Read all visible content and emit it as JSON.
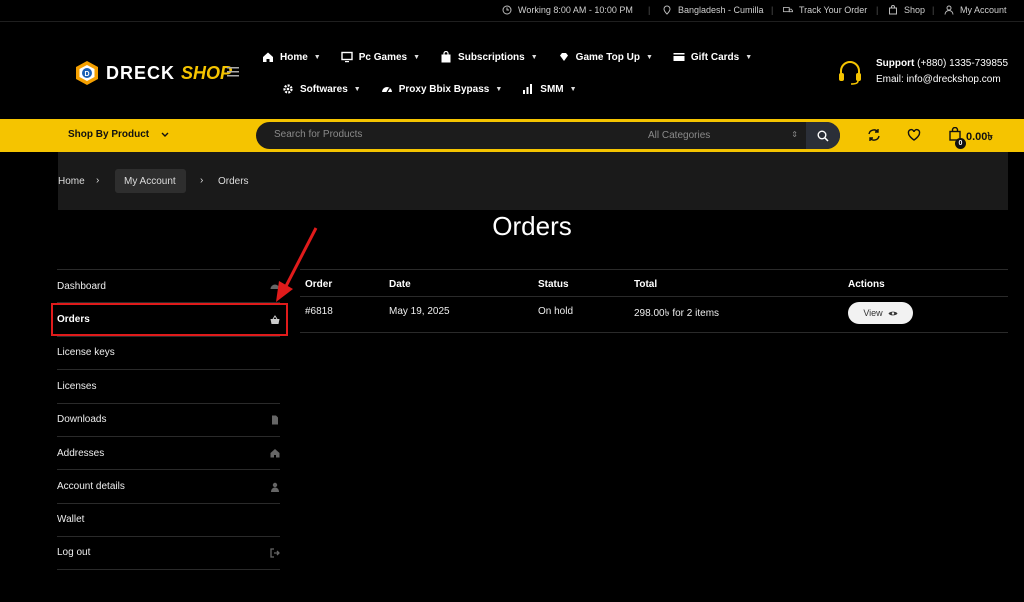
{
  "topbar": {
    "hours": "Working 8:00 AM - 10:00 PM",
    "location": "Bangladesh - Cumilla",
    "track": "Track Your Order",
    "shop": "Shop",
    "account": "My Account"
  },
  "brand": {
    "name_1": "DRECK",
    "name_2": "SHOP",
    "accent": "#f5c400"
  },
  "nav": {
    "row1": [
      {
        "label": "Home",
        "icon": "home-icon"
      },
      {
        "label": "Pc Games",
        "icon": "monitor-icon"
      },
      {
        "label": "Subscriptions",
        "icon": "bag-icon"
      },
      {
        "label": "Game Top Up",
        "icon": "diamond-icon"
      },
      {
        "label": "Gift Cards",
        "icon": "card-icon"
      }
    ],
    "row2": [
      {
        "label": "Softwares",
        "icon": "gear-icon"
      },
      {
        "label": "Proxy Bbix Bypass",
        "icon": "gauge-icon"
      },
      {
        "label": "SMM",
        "icon": "bars-icon"
      }
    ]
  },
  "support": {
    "label": "Support",
    "phone": "(+880) 1335-739855",
    "email": "Email: info@dreckshop.com"
  },
  "ybar": {
    "shop_by": "Shop By Product",
    "search_placeholder": "Search for Products",
    "category": "All Categories",
    "cart_count": "0",
    "cart_total": "0.00৳"
  },
  "breadcrumb": {
    "home": "Home",
    "account": "My Account",
    "current": "Orders"
  },
  "page": {
    "title": "Orders"
  },
  "sidebar": {
    "items": [
      {
        "label": "Dashboard"
      },
      {
        "label": "Orders"
      },
      {
        "label": "License keys"
      },
      {
        "label": "Licenses"
      },
      {
        "label": "Downloads"
      },
      {
        "label": "Addresses"
      },
      {
        "label": "Account details"
      },
      {
        "label": "Wallet"
      },
      {
        "label": "Log out"
      }
    ]
  },
  "orders": {
    "headers": {
      "order": "Order",
      "date": "Date",
      "status": "Status",
      "total": "Total",
      "actions": "Actions"
    },
    "rows": [
      {
        "order": "#6818",
        "date": "May 19, 2025",
        "status": "On hold",
        "total": "298.00৳  for 2 items",
        "action": "View"
      }
    ]
  },
  "annotation_color": "#e01b1b"
}
